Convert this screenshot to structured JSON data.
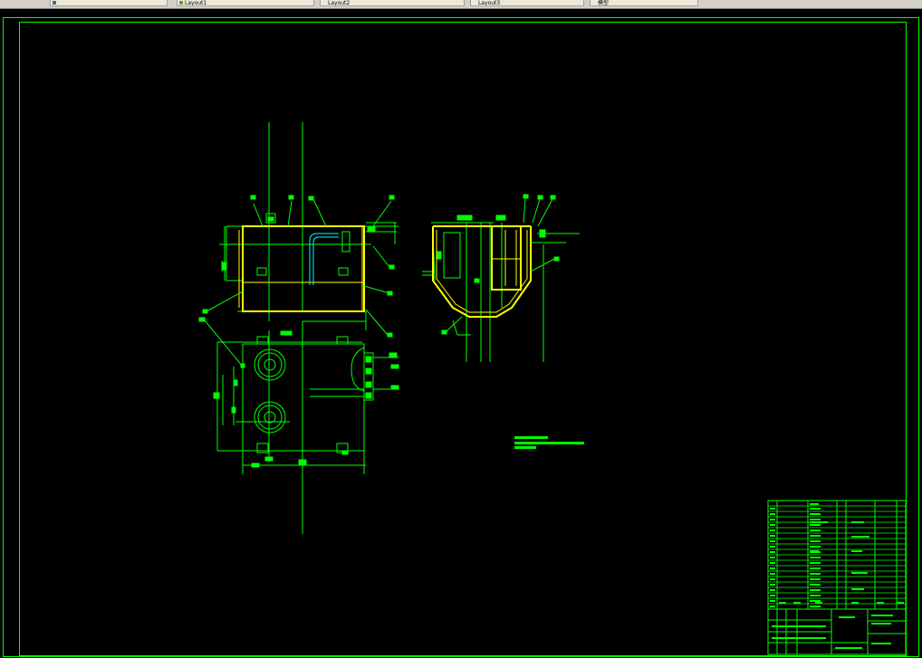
{
  "tabs": [
    {
      "label": ""
    },
    {
      "label": "Layout1"
    },
    {
      "label": "Layout2"
    },
    {
      "label": "Layout3"
    },
    {
      "label": "模型"
    }
  ],
  "drawing": {
    "border_color": "#00ff00",
    "geometry_color": "#ffff00",
    "centerline_color": "#00ff00",
    "background": "#000000"
  }
}
